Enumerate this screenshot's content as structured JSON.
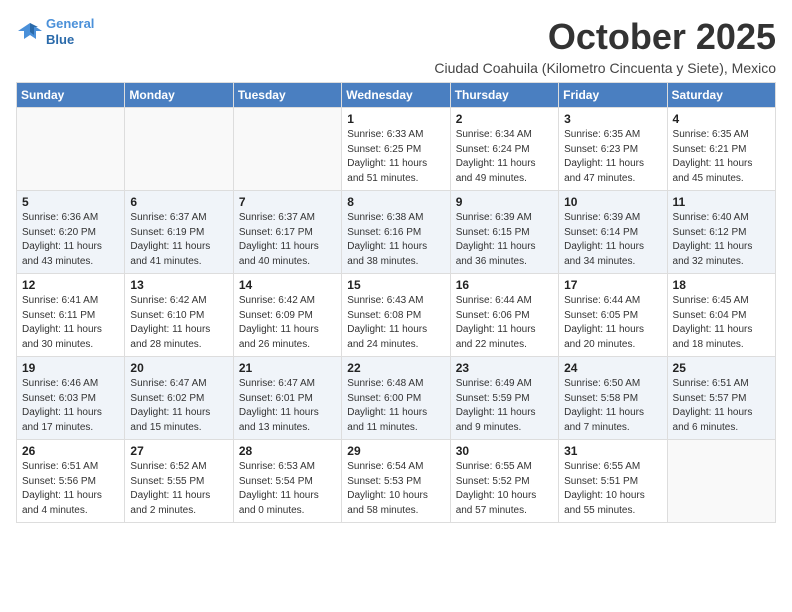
{
  "logo": {
    "line1": "General",
    "line2": "Blue"
  },
  "title": "October 2025",
  "location": "Ciudad Coahuila (Kilometro Cincuenta y Siete), Mexico",
  "weekdays": [
    "Sunday",
    "Monday",
    "Tuesday",
    "Wednesday",
    "Thursday",
    "Friday",
    "Saturday"
  ],
  "weeks": [
    [
      {
        "day": "",
        "info": ""
      },
      {
        "day": "",
        "info": ""
      },
      {
        "day": "",
        "info": ""
      },
      {
        "day": "1",
        "info": "Sunrise: 6:33 AM\nSunset: 6:25 PM\nDaylight: 11 hours and 51 minutes."
      },
      {
        "day": "2",
        "info": "Sunrise: 6:34 AM\nSunset: 6:24 PM\nDaylight: 11 hours and 49 minutes."
      },
      {
        "day": "3",
        "info": "Sunrise: 6:35 AM\nSunset: 6:23 PM\nDaylight: 11 hours and 47 minutes."
      },
      {
        "day": "4",
        "info": "Sunrise: 6:35 AM\nSunset: 6:21 PM\nDaylight: 11 hours and 45 minutes."
      }
    ],
    [
      {
        "day": "5",
        "info": "Sunrise: 6:36 AM\nSunset: 6:20 PM\nDaylight: 11 hours and 43 minutes."
      },
      {
        "day": "6",
        "info": "Sunrise: 6:37 AM\nSunset: 6:19 PM\nDaylight: 11 hours and 41 minutes."
      },
      {
        "day": "7",
        "info": "Sunrise: 6:37 AM\nSunset: 6:17 PM\nDaylight: 11 hours and 40 minutes."
      },
      {
        "day": "8",
        "info": "Sunrise: 6:38 AM\nSunset: 6:16 PM\nDaylight: 11 hours and 38 minutes."
      },
      {
        "day": "9",
        "info": "Sunrise: 6:39 AM\nSunset: 6:15 PM\nDaylight: 11 hours and 36 minutes."
      },
      {
        "day": "10",
        "info": "Sunrise: 6:39 AM\nSunset: 6:14 PM\nDaylight: 11 hours and 34 minutes."
      },
      {
        "day": "11",
        "info": "Sunrise: 6:40 AM\nSunset: 6:12 PM\nDaylight: 11 hours and 32 minutes."
      }
    ],
    [
      {
        "day": "12",
        "info": "Sunrise: 6:41 AM\nSunset: 6:11 PM\nDaylight: 11 hours and 30 minutes."
      },
      {
        "day": "13",
        "info": "Sunrise: 6:42 AM\nSunset: 6:10 PM\nDaylight: 11 hours and 28 minutes."
      },
      {
        "day": "14",
        "info": "Sunrise: 6:42 AM\nSunset: 6:09 PM\nDaylight: 11 hours and 26 minutes."
      },
      {
        "day": "15",
        "info": "Sunrise: 6:43 AM\nSunset: 6:08 PM\nDaylight: 11 hours and 24 minutes."
      },
      {
        "day": "16",
        "info": "Sunrise: 6:44 AM\nSunset: 6:06 PM\nDaylight: 11 hours and 22 minutes."
      },
      {
        "day": "17",
        "info": "Sunrise: 6:44 AM\nSunset: 6:05 PM\nDaylight: 11 hours and 20 minutes."
      },
      {
        "day": "18",
        "info": "Sunrise: 6:45 AM\nSunset: 6:04 PM\nDaylight: 11 hours and 18 minutes."
      }
    ],
    [
      {
        "day": "19",
        "info": "Sunrise: 6:46 AM\nSunset: 6:03 PM\nDaylight: 11 hours and 17 minutes."
      },
      {
        "day": "20",
        "info": "Sunrise: 6:47 AM\nSunset: 6:02 PM\nDaylight: 11 hours and 15 minutes."
      },
      {
        "day": "21",
        "info": "Sunrise: 6:47 AM\nSunset: 6:01 PM\nDaylight: 11 hours and 13 minutes."
      },
      {
        "day": "22",
        "info": "Sunrise: 6:48 AM\nSunset: 6:00 PM\nDaylight: 11 hours and 11 minutes."
      },
      {
        "day": "23",
        "info": "Sunrise: 6:49 AM\nSunset: 5:59 PM\nDaylight: 11 hours and 9 minutes."
      },
      {
        "day": "24",
        "info": "Sunrise: 6:50 AM\nSunset: 5:58 PM\nDaylight: 11 hours and 7 minutes."
      },
      {
        "day": "25",
        "info": "Sunrise: 6:51 AM\nSunset: 5:57 PM\nDaylight: 11 hours and 6 minutes."
      }
    ],
    [
      {
        "day": "26",
        "info": "Sunrise: 6:51 AM\nSunset: 5:56 PM\nDaylight: 11 hours and 4 minutes."
      },
      {
        "day": "27",
        "info": "Sunrise: 6:52 AM\nSunset: 5:55 PM\nDaylight: 11 hours and 2 minutes."
      },
      {
        "day": "28",
        "info": "Sunrise: 6:53 AM\nSunset: 5:54 PM\nDaylight: 11 hours and 0 minutes."
      },
      {
        "day": "29",
        "info": "Sunrise: 6:54 AM\nSunset: 5:53 PM\nDaylight: 10 hours and 58 minutes."
      },
      {
        "day": "30",
        "info": "Sunrise: 6:55 AM\nSunset: 5:52 PM\nDaylight: 10 hours and 57 minutes."
      },
      {
        "day": "31",
        "info": "Sunrise: 6:55 AM\nSunset: 5:51 PM\nDaylight: 10 hours and 55 minutes."
      },
      {
        "day": "",
        "info": ""
      }
    ]
  ]
}
